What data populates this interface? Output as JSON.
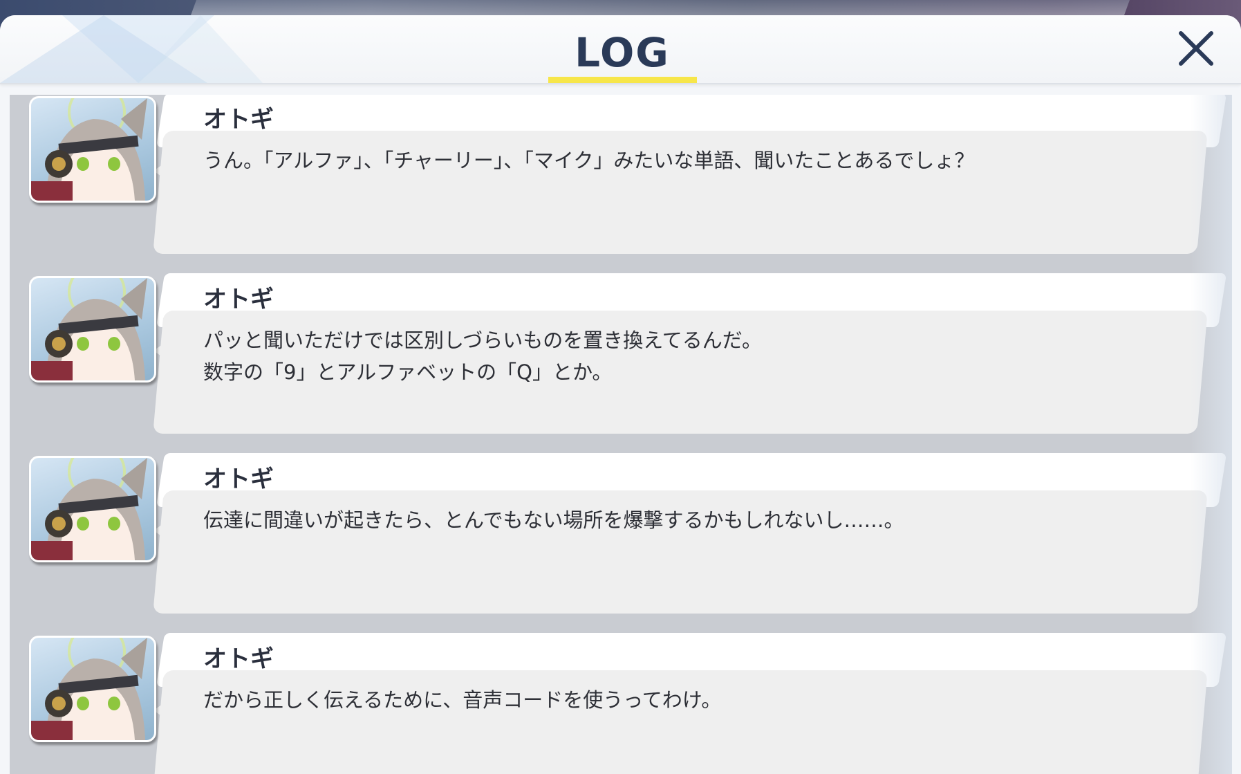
{
  "header": {
    "title": "LOG",
    "close_icon": "close-x-icon"
  },
  "colors": {
    "title": "#2a3a58",
    "underline": "#f7e64a",
    "list_background": "#c9ccd2",
    "bubble": "#efefef"
  },
  "log": {
    "entries": [
      {
        "speaker": "オトギ",
        "message": "うん。「アルファ」、「チャーリー」、「マイク」みたいな単語、聞いたことあるでしょ？",
        "avatar": "speaker-avatar-icon"
      },
      {
        "speaker": "オトギ",
        "message": "パッと聞いただけでは区別しづらいものを置き換えてるんだ。\n数字の「9」とアルファベットの「Q」とか。",
        "avatar": "speaker-avatar-icon"
      },
      {
        "speaker": "オトギ",
        "message": "伝達に間違いが起きたら、とんでもない場所を爆撃するかもしれないし……。",
        "avatar": "speaker-avatar-icon"
      },
      {
        "speaker": "オトギ",
        "message": "だから正しく伝えるために、音声コードを使うってわけ。",
        "avatar": "speaker-avatar-icon"
      }
    ]
  }
}
